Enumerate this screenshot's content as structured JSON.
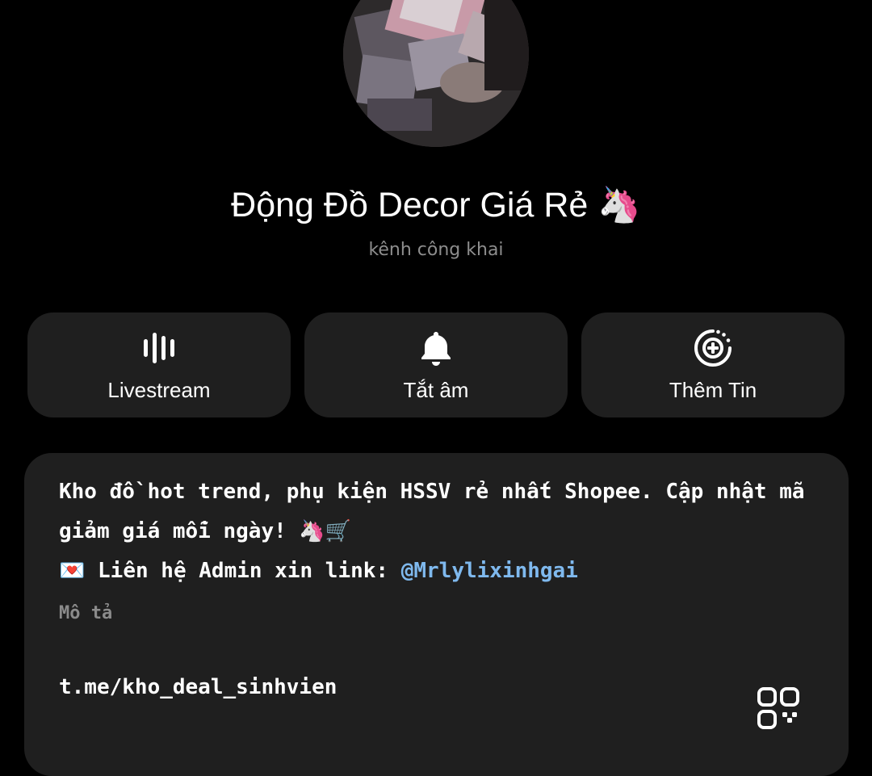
{
  "channel": {
    "name": "Động Đồ Decor Giá Rẻ",
    "name_emoji": "🦄",
    "type_label": "kênh công khai"
  },
  "actions": [
    {
      "label": "Livestream",
      "icon": "livestream-icon"
    },
    {
      "label": "Tắt âm",
      "icon": "bell-icon"
    },
    {
      "label": "Thêm Tin",
      "icon": "add-story-icon"
    }
  ],
  "info": {
    "description_line1": "Kho đồ hot trend, phụ kiện HSSV rẻ nhất Shopee. Cập nhật mã",
    "description_line2": "giảm giá mỗi ngày!",
    "description_line2_emoji": "🦄🛒",
    "contact_emoji": "💌",
    "contact_text": "Liên hệ Admin xin link:",
    "contact_mention": "@Mrlylixinhgai",
    "description_label": "Mô tả",
    "link": "t.me/kho_deal_sinhvien",
    "qr_icon": "qr-code-icon"
  },
  "colors": {
    "background": "#000000",
    "card": "#1f1f1f",
    "mention": "#7fb9ee",
    "secondary_text": "#8d8d8d"
  }
}
